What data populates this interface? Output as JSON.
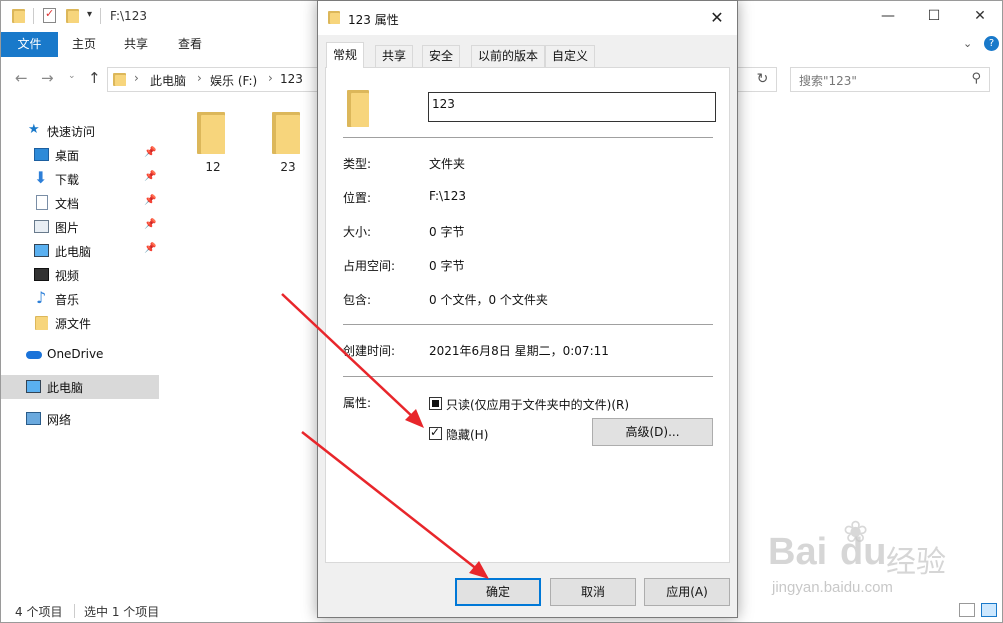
{
  "explorer": {
    "title": "F:\\123",
    "ribbon_tabs": {
      "file": "文件",
      "home": "主页",
      "share": "共享",
      "view": "查看"
    },
    "breadcrumb": [
      "此电脑",
      "娱乐 (F:)",
      "123"
    ],
    "search_placeholder": "搜索\"123\"",
    "nav": {
      "quick_access": "快速访问",
      "desktop": "桌面",
      "downloads": "下载",
      "documents": "文档",
      "pictures": "图片",
      "this_pc_pinned": "此电脑",
      "videos": "视频",
      "music": "音乐",
      "source_files": "源文件",
      "onedrive": "OneDrive",
      "this_pc": "此电脑",
      "network": "网络"
    },
    "items": [
      "12",
      "23"
    ],
    "status": {
      "count": "4 个项目",
      "selected": "选中 1 个项目"
    }
  },
  "dialog": {
    "title": "123 属性",
    "tabs": [
      "常规",
      "共享",
      "安全",
      "以前的版本",
      "自定义"
    ],
    "name_value": "123",
    "props": {
      "type_label": "类型:",
      "type_value": "文件夹",
      "location_label": "位置:",
      "location_value": "F:\\123",
      "size_label": "大小:",
      "size_value": "0 字节",
      "disk_label": "占用空间:",
      "disk_value": "0 字节",
      "contains_label": "包含:",
      "contains_value": "0 个文件，0 个文件夹",
      "created_label": "创建时间:",
      "created_value": "2021年6月8日 星期二，0:07:11",
      "attributes_label": "属性:"
    },
    "readonly_label": "只读(仅应用于文件夹中的文件)(R)",
    "hidden_label": "隐藏(H)",
    "hidden_checked": true,
    "advanced_button": "高级(D)...",
    "ok_button": "确定",
    "cancel_button": "取消",
    "apply_button": "应用(A)"
  },
  "watermark": {
    "brand": "Bai",
    "brand2": "du",
    "brand_cn": "经验",
    "url": "jingyan.baidu.com"
  },
  "colors": {
    "accent": "#1979ca",
    "arrow": "#e8262b",
    "folder": "#f7d57c"
  }
}
